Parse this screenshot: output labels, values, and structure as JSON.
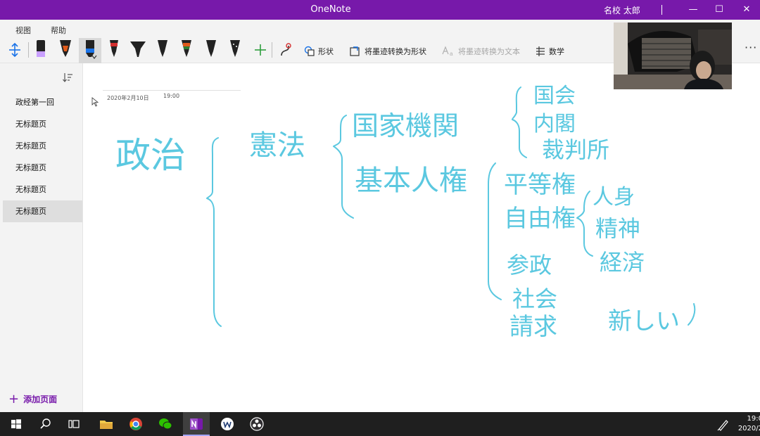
{
  "titlebar": {
    "app_title": "OneNote",
    "user_name": "名校 太郎",
    "minimize": "—",
    "maximize": "☐",
    "close": "✕"
  },
  "ribbon": {
    "menu": [
      "视图",
      "帮助"
    ],
    "pen_colors": [
      "#000000",
      "#e05a1a",
      "#1a73e8",
      "#d32f2f",
      "#000000",
      "#000000",
      "#2e7d32",
      "#000000",
      "#000000"
    ],
    "buttons": {
      "shapes": "形状",
      "ink_to_shape": "将墨迹转换为形状",
      "ink_to_text": "将墨迹转换为文本",
      "math": "数学"
    },
    "more": "···"
  },
  "sidebar": {
    "pages": [
      "政经第一回",
      "无标题页",
      "无标题页",
      "无标题页",
      "无标题页",
      "无标题页"
    ],
    "selected_index": 5,
    "add_page": "添加页面"
  },
  "page": {
    "date": "2020年2月10日",
    "time": "19:00"
  },
  "handwriting": {
    "ink_color": "#5bc8e0",
    "lines": [
      "政治",
      "憲法",
      "国家機関",
      "基本人権",
      "国会",
      "内閣",
      "裁判所",
      "平等権",
      "自由権",
      "参政",
      "社会",
      "請求",
      "人身",
      "精神",
      "経済",
      "新しい"
    ]
  },
  "taskbar": {
    "time": "19:0",
    "date": "2020/2"
  },
  "colors": {
    "accent": "#7719aa",
    "ink": "#5bc8e0"
  }
}
